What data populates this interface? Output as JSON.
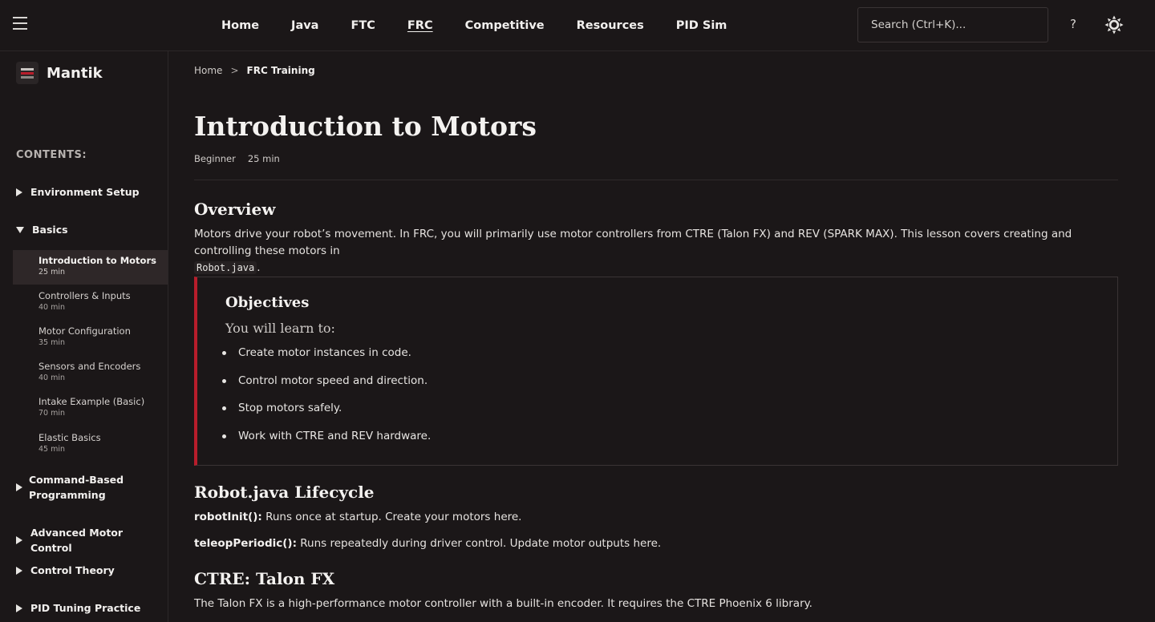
{
  "topbar": {
    "nav": [
      {
        "label": "Home",
        "active": false
      },
      {
        "label": "Java",
        "active": false
      },
      {
        "label": "FTC",
        "active": false
      },
      {
        "label": "FRC",
        "active": true
      },
      {
        "label": "Competitive",
        "active": false
      },
      {
        "label": "Resources",
        "active": false
      },
      {
        "label": "PID Sim",
        "active": false
      }
    ],
    "search_placeholder": "Search (Ctrl+K)...",
    "help_label": "?"
  },
  "sidebar": {
    "brand": "Mantik",
    "contents_label": "CONTENTS:",
    "sections": [
      {
        "label": "Environment Setup",
        "expanded": false
      },
      {
        "label": "Basics",
        "expanded": true
      },
      {
        "label": "Command-Based Programming",
        "expanded": false
      },
      {
        "label": "Advanced Motor Control",
        "expanded": false
      },
      {
        "label": "Control Theory",
        "expanded": false
      },
      {
        "label": "PID Tuning Practice",
        "expanded": false
      }
    ],
    "section_multiline": [
      "Command-Based",
      "Programming"
    ],
    "lessons": [
      {
        "title": "Introduction to Motors",
        "duration": "25 min",
        "active": true
      },
      {
        "title": "Controllers & Inputs",
        "duration": "40 min",
        "active": false
      },
      {
        "title": "Motor Configuration",
        "duration": "35 min",
        "active": false
      },
      {
        "title": "Sensors and Encoders",
        "duration": "40 min",
        "active": false
      },
      {
        "title": "Intake Example (Basic)",
        "duration": "70 min",
        "active": false
      },
      {
        "title": "Elastic Basics",
        "duration": "45 min",
        "active": false
      }
    ]
  },
  "breadcrumb": {
    "home": "Home",
    "sep": ">",
    "current": "FRC Training"
  },
  "page": {
    "title": "Introduction to Motors",
    "level": "Beginner",
    "duration": "25 min",
    "overview_heading": "Overview",
    "overview_text": "Motors drive your robot’s movement. In FRC, you will primarily use motor controllers from CTRE (Talon FX) and REV (SPARK MAX). This lesson covers creating and controlling these motors in",
    "overview_code": "Robot.java",
    "overview_end": ".",
    "objectives": {
      "heading": "Objectives",
      "sub": "You will learn to:",
      "items": [
        "Create motor instances in code.",
        "Control motor speed and direction.",
        "Stop motors safely.",
        "Work with CTRE and REV hardware."
      ]
    },
    "lifecycle_heading": "Robot.java Lifecycle",
    "lifecycle": [
      {
        "key": "robotInit():",
        "text": " Runs once at startup. Create your motors here."
      },
      {
        "key": "teleopPeriodic():",
        "text": " Runs repeatedly during driver control. Update motor outputs here."
      }
    ],
    "ctre_heading": "CTRE: Talon FX",
    "ctre_text": "The Talon FX is a high-performance motor controller with a built-in encoder. It requires the CTRE Phoenix 6 library."
  },
  "colors": {
    "accent": "#b81d2b",
    "background": "#1b1718",
    "active_item": "#2e2728"
  }
}
